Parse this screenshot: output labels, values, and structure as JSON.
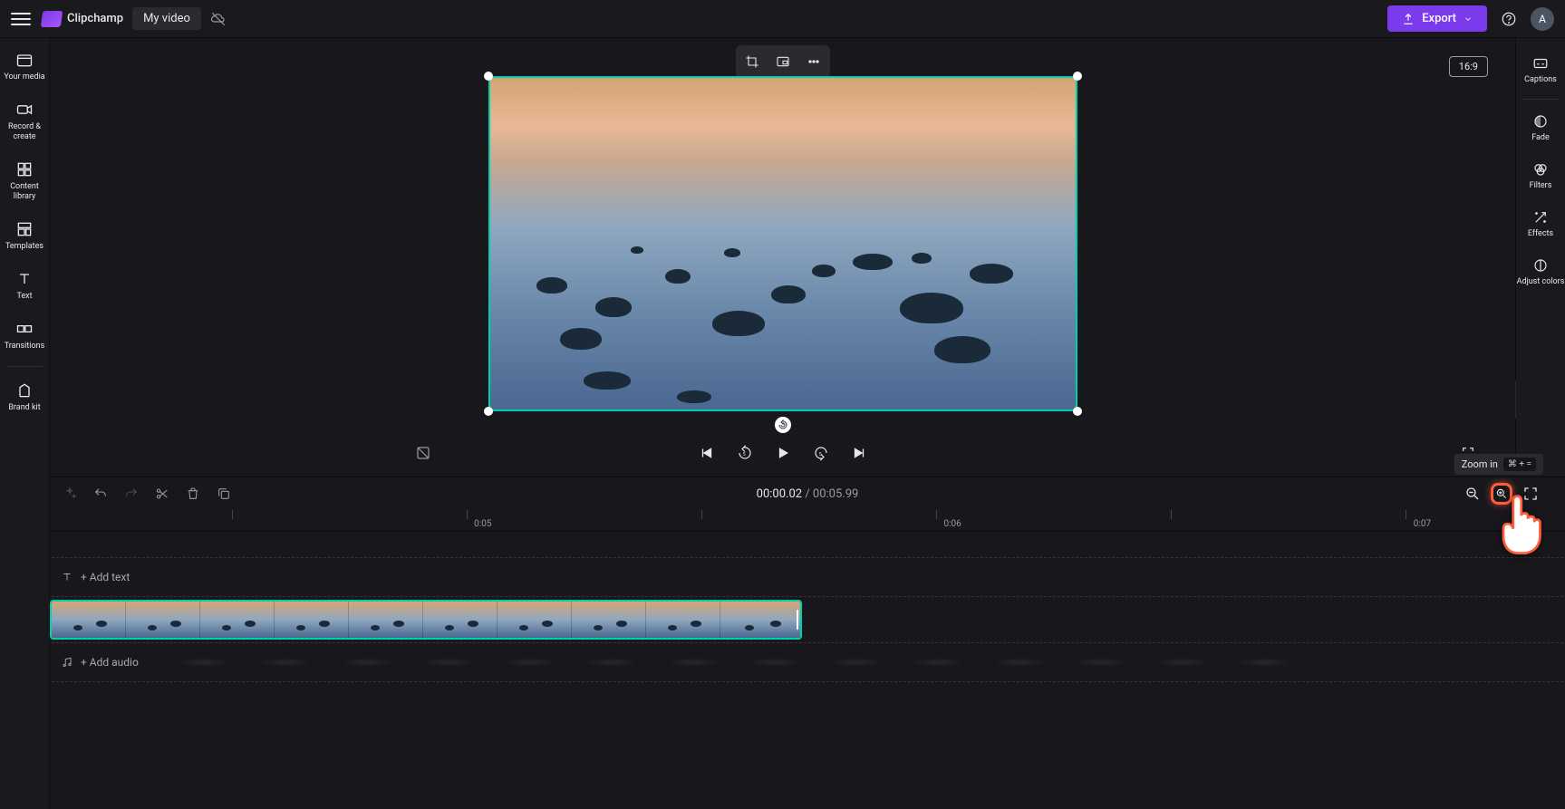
{
  "app": {
    "name": "Clipchamp",
    "projectName": "My video"
  },
  "topbar": {
    "exportLabel": "Export",
    "avatarLetter": "A"
  },
  "leftSidebar": {
    "items": [
      {
        "key": "your-media",
        "label": "Your media"
      },
      {
        "key": "record-create",
        "label": "Record & create"
      },
      {
        "key": "content-library",
        "label": "Content library"
      },
      {
        "key": "templates",
        "label": "Templates"
      },
      {
        "key": "text",
        "label": "Text"
      },
      {
        "key": "transitions",
        "label": "Transitions"
      },
      {
        "key": "brand-kit",
        "label": "Brand kit"
      }
    ]
  },
  "rightSidebar": {
    "items": [
      {
        "key": "captions",
        "label": "Captions"
      },
      {
        "key": "fade",
        "label": "Fade"
      },
      {
        "key": "filters",
        "label": "Filters"
      },
      {
        "key": "effects",
        "label": "Effects"
      },
      {
        "key": "adjust-colors",
        "label": "Adjust colors"
      }
    ]
  },
  "preview": {
    "aspectRatio": "16:9"
  },
  "playback": {
    "currentTime": "00:00.02",
    "duration": "00:05.99"
  },
  "timeline": {
    "ticks": [
      "0:05",
      "0:06",
      "0:07"
    ],
    "addTextLabel": "+ Add text",
    "addAudioLabel": "+ Add audio"
  },
  "tooltip": {
    "zoomInLabel": "Zoom in",
    "zoomInShortcut": "⌘ + ="
  }
}
